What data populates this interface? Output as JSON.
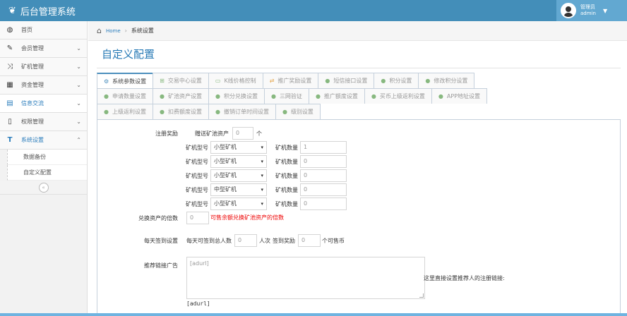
{
  "app": {
    "title": "后台管理系统",
    "logo_icon": "leaf-icon"
  },
  "user": {
    "role": "管理员",
    "name": "admin"
  },
  "sidebar": {
    "items": [
      {
        "label": "首页",
        "icon": "dashboard-icon",
        "has_chevron": false
      },
      {
        "label": "会员管理",
        "icon": "edit-icon",
        "has_chevron": true
      },
      {
        "label": "矿机管理",
        "icon": "random-icon",
        "has_chevron": true
      },
      {
        "label": "资金管理",
        "icon": "calendar-icon",
        "has_chevron": true
      },
      {
        "label": "信息交流",
        "icon": "list-icon",
        "has_chevron": true
      },
      {
        "label": "权限管理",
        "icon": "file-icon",
        "has_chevron": true
      },
      {
        "label": "系统设置",
        "icon": "text-icon",
        "has_chevron": true
      }
    ],
    "sub_items": [
      "数据备份",
      "自定义配置"
    ],
    "collapse_symbol": "«"
  },
  "breadcrumb": {
    "home": "Home",
    "current": "系统设置"
  },
  "page": {
    "title": "自定义配置"
  },
  "tabs": {
    "row1": [
      "系统参数设置",
      "交易中心设置",
      "K线价格控制",
      "推广奖励设置",
      "短信接口设置",
      "积分设置",
      "修改积分设置"
    ],
    "row2": [
      "申请数量设置",
      "矿池资产设置",
      "积分兑换设置",
      "三网验证",
      "推广额度设置",
      "买币上级返利设置",
      "APP地址设置"
    ],
    "row3": [
      "上级返利设置",
      "扣费额度设置",
      "撤销订单时间设置",
      "级别设置"
    ]
  },
  "form": {
    "register_reward": {
      "label": "注册奖励",
      "gift_label": "赠送矿池资产",
      "gift_value": "0",
      "gift_unit": "个",
      "machine_type_label": "矿机型号",
      "machine_count_label": "矿机数量",
      "rows": [
        {
          "type": "小型矿机",
          "count": "1"
        },
        {
          "type": "小型矿机",
          "count": "0"
        },
        {
          "type": "小型矿机",
          "count": "0"
        },
        {
          "type": "中型矿机",
          "count": "0"
        },
        {
          "type": "小型矿机",
          "count": "0"
        }
      ]
    },
    "exchange": {
      "label": "兑换资产的倍数",
      "value": "0",
      "hint": "可售余额兑换矿池资产的倍数"
    },
    "signin": {
      "label": "每天签到设置",
      "people_label": "每天可签到总人数",
      "people_value": "0",
      "people_unit": "人次",
      "reward_label": "签到奖励",
      "reward_value": "0",
      "reward_unit": "个可售币"
    },
    "ad": {
      "label": "推荐链接广告",
      "placeholder": "[adurl]",
      "note": "这里直接设置推荐人的注册链接:",
      "footer": "[adurl]"
    }
  }
}
